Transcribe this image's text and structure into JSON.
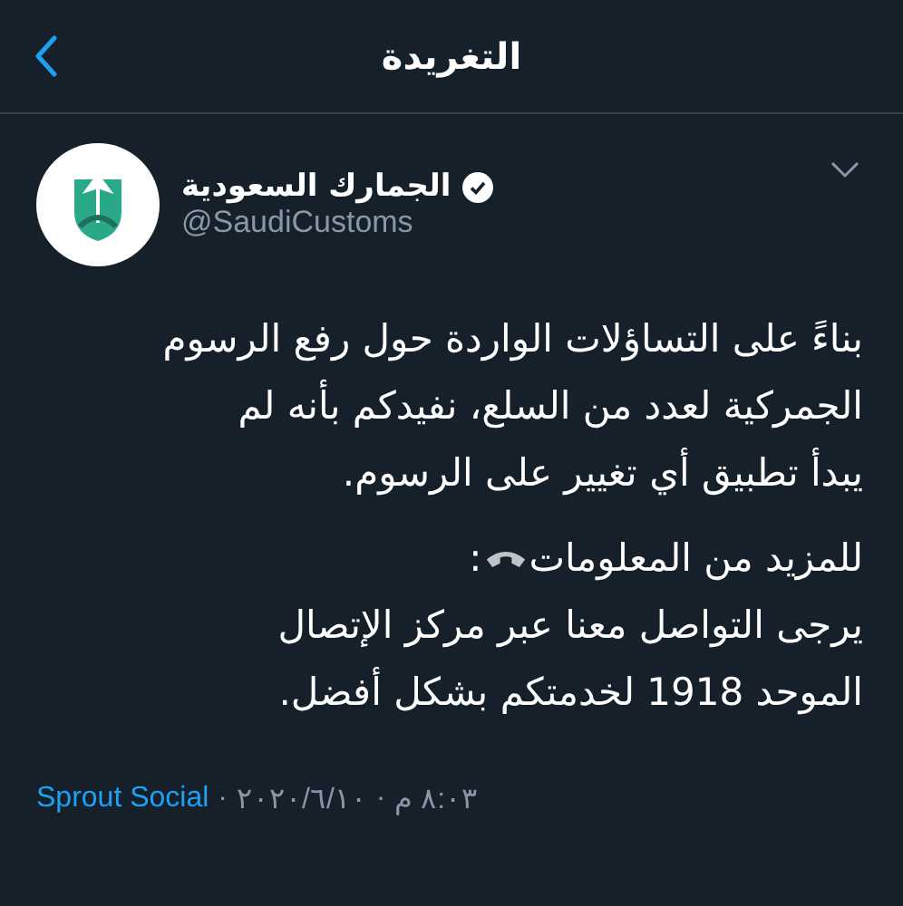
{
  "header": {
    "title": "التغريدة"
  },
  "author": {
    "name": "الجمارك السعودية",
    "verified": true,
    "handle": "@SaudiCustoms"
  },
  "tweet": {
    "paragraphs": [
      "بناءً على التساؤلات الواردة حول رفع الرسوم\nالجمركية لعدد من السلع، نفيدكم بأنه لم\nيبدأ تطبيق أي تغيير على الرسوم."
    ],
    "info_line": {
      "text": "للمزيد من المعلومات",
      "suffix": ":"
    },
    "closing": "يرجى التواصل معنا عبر مركز الإتصال\nالموحد 1918 لخدمتكم بشكل أفضل."
  },
  "meta": {
    "source": "Sprout Social",
    "separator": "·",
    "date": "٢٠٢٠/٦/١٠",
    "time": "٨:٠٣ م"
  }
}
